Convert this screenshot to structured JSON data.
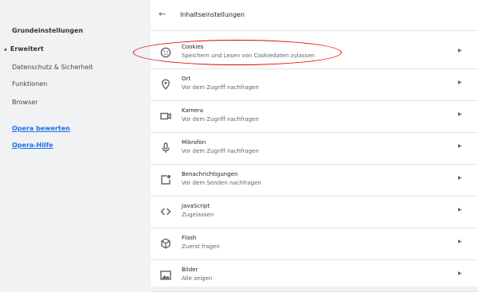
{
  "sidebar": {
    "grundeinstellungen": "Grundeinstellungen",
    "erweitert": "Erweitert",
    "items": [
      "Datenschutz & Sicherheit",
      "Funktionen",
      "Browser"
    ],
    "links": [
      "Opera bewerten",
      "Opera-Hilfe"
    ]
  },
  "header": {
    "back_icon": "arrow-left-icon",
    "title": "Inhaltseinstellungen"
  },
  "settings": [
    {
      "name": "Cookies",
      "desc": "Speichern und Lesen von Cookiedaten zulassen",
      "icon": "cookie-icon"
    },
    {
      "name": "Ort",
      "desc": "Vor dem Zugriff nachfragen",
      "icon": "location-pin-icon"
    },
    {
      "name": "Kamera",
      "desc": "Vor dem Zugriff nachfragen",
      "icon": "camera-icon"
    },
    {
      "name": "Mikrofon",
      "desc": "Vor dem Zugriff nachfragen",
      "icon": "microphone-icon"
    },
    {
      "name": "Benachrichtigungen",
      "desc": "Vor dem Senden nachfragen",
      "icon": "notification-icon"
    },
    {
      "name": "JavaScript",
      "desc": "Zugelassen",
      "icon": "code-icon"
    },
    {
      "name": "Flash",
      "desc": "Zuerst fragen",
      "icon": "puzzle-piece-icon"
    },
    {
      "name": "Bilder",
      "desc": "Alle zeigen",
      "icon": "image-icon"
    }
  ],
  "colors": {
    "link": "#1a73e8",
    "annotation": "#e00000",
    "background": "#f1f2f4"
  }
}
